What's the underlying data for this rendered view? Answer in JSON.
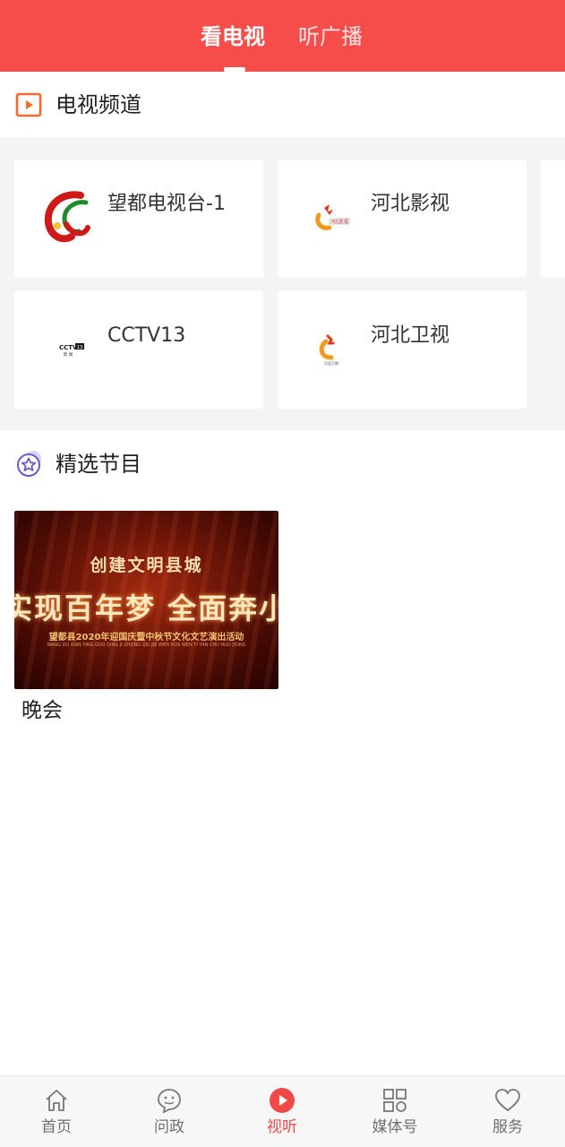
{
  "header": {
    "tabs": [
      {
        "label": "看电视",
        "active": true
      },
      {
        "label": "听广播",
        "active": false
      }
    ],
    "background_color": "#f64c4a"
  },
  "tv_section": {
    "title": "电视频道",
    "icon": "play-square-icon",
    "channels": [
      {
        "name": "望都电视台-1",
        "logo": "wangdu-tv-logo"
      },
      {
        "name": "河北影视",
        "logo": "hebei-film-logo"
      },
      {
        "name": "CCTV13",
        "logo": "cctv13-logo"
      },
      {
        "name": "河北卫视",
        "logo": "hebei-satellite-logo"
      }
    ]
  },
  "programs_section": {
    "title": "精选节目",
    "icon": "star-circle-icon",
    "programs": [
      {
        "label": "晚会",
        "thumbnail": {
          "line1": "创建文明县城",
          "line2": "实现百年梦 全面奔小康",
          "line3": "望都县2020年迎国庆暨中秋节文化文艺演出活动",
          "line4": "WANG DU XIAN YING GUO QING JI ZHONG QIU JIE WEN HUA WEN YI YAN CHU HUO DONG"
        }
      }
    ]
  },
  "bottom_nav": {
    "items": [
      {
        "label": "首页",
        "icon": "home-icon",
        "active": false
      },
      {
        "label": "问政",
        "icon": "chat-bubble-icon",
        "active": false
      },
      {
        "label": "视听",
        "icon": "play-circle-icon",
        "active": true
      },
      {
        "label": "媒体号",
        "icon": "grid-icon",
        "active": false
      },
      {
        "label": "服务",
        "icon": "heart-icon",
        "active": false
      }
    ],
    "active_color": "#f04a48",
    "inactive_color": "#6f6f6f"
  }
}
